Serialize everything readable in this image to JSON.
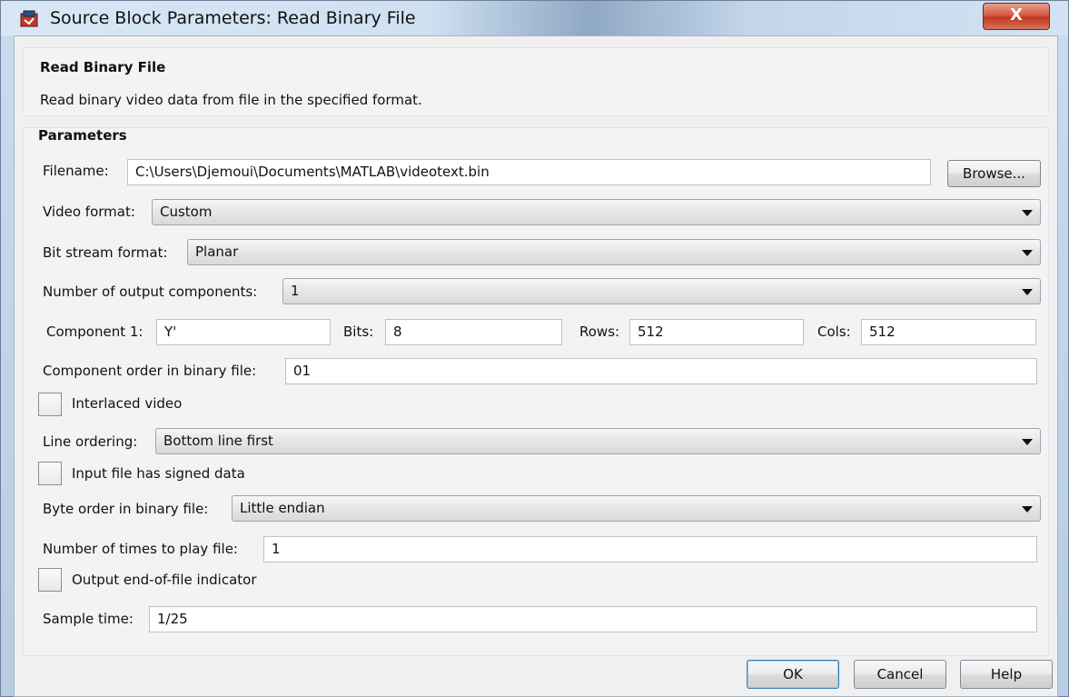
{
  "window": {
    "title": "Source Block Parameters: Read Binary File",
    "close_label": "X"
  },
  "description": {
    "heading": "Read Binary File",
    "text": "Read binary video data from file in the specified format."
  },
  "parameters": {
    "heading": "Parameters",
    "filename_label": "Filename:",
    "filename_value": "C:\\Users\\Djemoui\\Documents\\MATLAB\\videotext.bin",
    "browse_label": "Browse...",
    "video_format_label": "Video format:",
    "video_format_value": "Custom",
    "bit_stream_label": "Bit stream format:",
    "bit_stream_value": "Planar",
    "num_components_label": "Number of output components:",
    "num_components_value": "1",
    "component1_label": "Component 1:",
    "component1_value": "Y'",
    "bits_label": "Bits:",
    "bits_value": "8",
    "rows_label": "Rows:",
    "rows_value": "512",
    "cols_label": "Cols:",
    "cols_value": "512",
    "component_order_label": "Component order in binary file:",
    "component_order_value": "01",
    "interlaced_label": "Interlaced video",
    "line_ordering_label": "Line ordering:",
    "line_ordering_value": "Bottom line first",
    "signed_data_label": "Input file has signed data",
    "byte_order_label": "Byte order in binary file:",
    "byte_order_value": "Little endian",
    "times_to_play_label": "Number of times to play file:",
    "times_to_play_value": "1",
    "eof_label": "Output end-of-file indicator",
    "sample_time_label": "Sample time:",
    "sample_time_value": "1/25"
  },
  "buttons": {
    "ok": "OK",
    "cancel": "Cancel",
    "help": "Help"
  }
}
